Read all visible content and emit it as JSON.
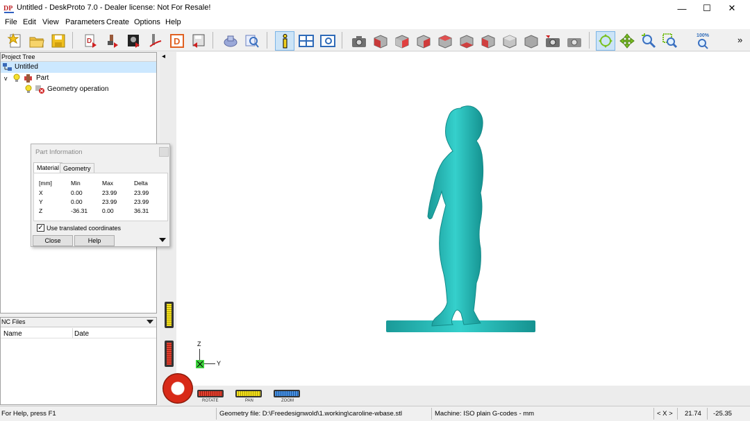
{
  "window": {
    "title": "Untitled - DeskProto 7.0 - Dealer license: Not For Resale!",
    "app_icon_text": "DP",
    "minimize": "—",
    "maximize": "☐",
    "close": "✕"
  },
  "menu": [
    "File",
    "Edit",
    "View",
    "Parameters",
    "Create",
    "Options",
    "Help"
  ],
  "toolbar": {
    "overflow": "»",
    "zoom_100": "100%"
  },
  "project_tree": {
    "header": "Project Tree",
    "root": "Untitled",
    "part": "Part",
    "operation": "Geometry operation",
    "expand_glyph": "v"
  },
  "nc_files": {
    "header": "NC Files",
    "col_name": "Name",
    "col_date": "Date"
  },
  "dialog": {
    "title": "Part Information",
    "tabs": [
      "Material",
      "Geometry"
    ],
    "headers": [
      "[mm]",
      "Min",
      "Max",
      "Delta"
    ],
    "rows": [
      [
        "X",
        "0.00",
        "23.99",
        "23.99"
      ],
      [
        "Y",
        "0.00",
        "23.99",
        "23.99"
      ],
      [
        "Z",
        "-36.31",
        "0.00",
        "36.31"
      ]
    ],
    "checkbox_label": "Use translated coordinates",
    "checkbox_checked": true,
    "close_button": "Close",
    "help_button": "Help"
  },
  "viewport": {
    "axis_z": "Z",
    "axis_y": "Y",
    "model_color": "#2ec4c0",
    "left_arrow": "◂"
  },
  "controls": {
    "rotate": "ROTATE",
    "pan": "PAN",
    "zoom": "ZOOM"
  },
  "status": {
    "help": "For Help, press F1",
    "geometry_file": "Geometry file: D:\\Freedesignwold\\1.working\\caroline-wbase.stl",
    "machine": "Machine: ISO plain G-codes - mm",
    "axis_nav": "< X >",
    "coord1": "21.74",
    "coord2": "-25.35"
  }
}
